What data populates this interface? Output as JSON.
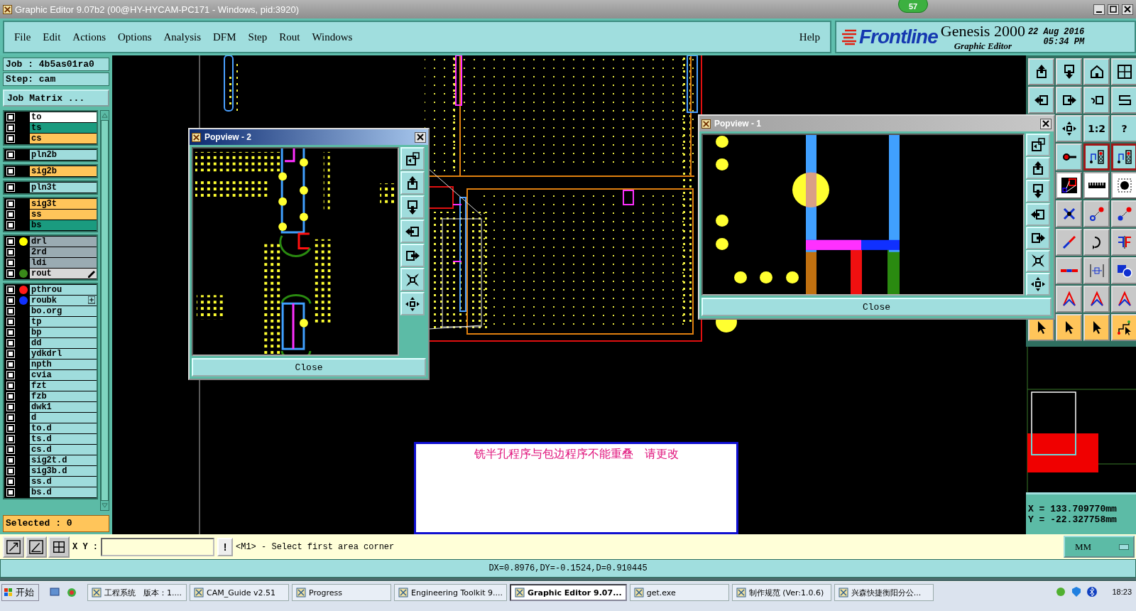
{
  "window": {
    "title": "Graphic Editor 9.07b2 (00@HY-HYCAM-PC171 - Windows, pid:3920)"
  },
  "notification_badge": "57",
  "menu": [
    "File",
    "Edit",
    "Actions",
    "Options",
    "Analysis",
    "DFM",
    "Step",
    "Rout",
    "Windows"
  ],
  "help_menu": "Help",
  "brand": {
    "logo": "Frontline",
    "product": "Genesis 2000",
    "subtitle": "Graphic Editor",
    "date": "22 Aug 2016",
    "time": "05:34 PM"
  },
  "job_panel": {
    "job": "Job : 4b5as01ra0",
    "step": "Step: cam",
    "matrix_button": "Job Matrix ...",
    "selected": "Selected : 0",
    "layer_groups": [
      {
        "layers": [
          {
            "name": "to",
            "color": "#ffffff",
            "checked": false,
            "kind": "plain"
          },
          {
            "name": "ts",
            "color": "#1a9b7f",
            "checked": false,
            "kind": "plain"
          },
          {
            "name": "cs",
            "color": "#ffc55a",
            "checked": false,
            "kind": "plain"
          }
        ]
      },
      {
        "layers": [
          {
            "name": "pln2b",
            "color": "#9fdcdc",
            "checked": false,
            "kind": "plain"
          }
        ]
      },
      {
        "layers": [
          {
            "name": "sig2b",
            "color": "#ffc55a",
            "checked": false,
            "kind": "plain"
          }
        ]
      },
      {
        "layers": [
          {
            "name": "pln3t",
            "color": "#9fdcdc",
            "checked": false,
            "kind": "plain"
          }
        ]
      },
      {
        "layers": [
          {
            "name": "sig3t",
            "color": "#ffc55a",
            "checked": false,
            "kind": "plain"
          },
          {
            "name": "ss",
            "color": "#ffc55a",
            "checked": false,
            "kind": "plain"
          },
          {
            "name": "bs",
            "color": "#1a9b7f",
            "checked": false,
            "kind": "plain"
          }
        ]
      },
      {
        "layers": [
          {
            "name": "drl",
            "color": "#9aabb2",
            "checked": false,
            "kind": "plain",
            "dot": {
              "color": "#ffff00"
            }
          },
          {
            "name": "2rd",
            "color": "#9aabb2",
            "checked": false,
            "kind": "plain"
          },
          {
            "name": "ldi",
            "color": "#9aabb2",
            "checked": false,
            "kind": "plain"
          },
          {
            "name": "rout",
            "color": "#d8d8d8",
            "checked": false,
            "kind": "work",
            "dot": {
              "color": "#3a8a1a"
            }
          }
        ]
      },
      {
        "layers": [
          {
            "name": "pthrou",
            "color": "#9fdcdc",
            "checked": false,
            "kind": "plain",
            "dot": {
              "color": "#ff1a1a"
            }
          },
          {
            "name": "roubk",
            "color": "#9fdcdc",
            "checked": false,
            "kind": "attr",
            "dot": {
              "color": "#1030ff"
            }
          },
          {
            "name": "bo.org",
            "color": "#9fdcdc",
            "checked": false,
            "kind": "plain"
          },
          {
            "name": "tp",
            "color": "#9fdcdc",
            "checked": false,
            "kind": "plain"
          },
          {
            "name": "bp",
            "color": "#9fdcdc",
            "checked": false,
            "kind": "plain"
          },
          {
            "name": "dd",
            "color": "#9fdcdc",
            "checked": false,
            "kind": "plain"
          },
          {
            "name": "ydkdrl",
            "color": "#9fdcdc",
            "checked": false,
            "kind": "plain"
          },
          {
            "name": "npth",
            "color": "#9fdcdc",
            "checked": false,
            "kind": "plain"
          },
          {
            "name": "cvia",
            "color": "#9fdcdc",
            "checked": false,
            "kind": "plain"
          },
          {
            "name": "fzt",
            "color": "#9fdcdc",
            "checked": false,
            "kind": "plain"
          },
          {
            "name": "fzb",
            "color": "#9fdcdc",
            "checked": false,
            "kind": "plain"
          },
          {
            "name": "dwk1",
            "color": "#9fdcdc",
            "checked": false,
            "kind": "plain"
          },
          {
            "name": "d",
            "color": "#9fdcdc",
            "checked": false,
            "kind": "plain"
          },
          {
            "name": "to.d",
            "color": "#9fdcdc",
            "checked": false,
            "kind": "plain"
          },
          {
            "name": "ts.d",
            "color": "#9fdcdc",
            "checked": false,
            "kind": "plain"
          },
          {
            "name": "cs.d",
            "color": "#9fdcdc",
            "checked": false,
            "kind": "plain"
          },
          {
            "name": "sig2t.d",
            "color": "#9fdcdc",
            "checked": false,
            "kind": "plain"
          },
          {
            "name": "sig3b.d",
            "color": "#9fdcdc",
            "checked": false,
            "kind": "plain"
          },
          {
            "name": "ss.d",
            "color": "#9fdcdc",
            "checked": false,
            "kind": "plain"
          },
          {
            "name": "bs.d",
            "color": "#9fdcdc",
            "checked": false,
            "kind": "plain"
          }
        ]
      }
    ]
  },
  "tool_palette": {
    "labels": [
      "1:2",
      "?"
    ]
  },
  "popviews": [
    {
      "title": "Popview - 2",
      "selected": true,
      "close": "Close"
    },
    {
      "title": "Popview - 1",
      "selected": false,
      "close": "Close"
    }
  ],
  "alert": {
    "message": "铣半孔程序与包边程序不能重叠　请更改"
  },
  "coordinates": {
    "x": "X = 133.709770mm",
    "y": "Y = -22.327758mm"
  },
  "command_bar": {
    "xy_label": "X Y :",
    "exclaim": "!",
    "prompt": "<M1> - Select first area corner",
    "units": "MM"
  },
  "status": "DX=0.8976,DY=-0.1524,D=0.910445",
  "taskbar": {
    "start": "开始",
    "tasks": [
      {
        "label": "工程系统　版本：1....",
        "selected": false
      },
      {
        "label": "CAM_Guide v2.51",
        "selected": false
      },
      {
        "label": "Progress",
        "selected": false
      },
      {
        "label": "Engineering Toolkit 9....",
        "selected": false
      },
      {
        "label": "Graphic Editor 9.07...",
        "selected": true
      },
      {
        "label": "get.exe",
        "selected": false
      },
      {
        "label": "制作规范 (Ver:1.0.6)",
        "selected": false
      },
      {
        "label": "兴森快捷衡阳分公...",
        "selected": false
      }
    ],
    "clock": "18:23"
  }
}
